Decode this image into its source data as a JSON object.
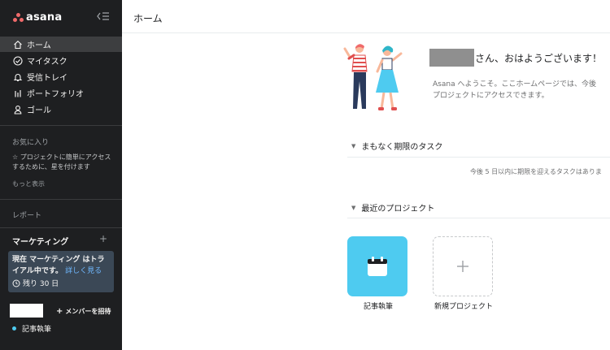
{
  "brand": {
    "name": "asana",
    "logo_color": "#f06a6a"
  },
  "sidebar": {
    "nav": [
      {
        "label": "ホーム",
        "icon": "home-icon",
        "active": true
      },
      {
        "label": "マイタスク",
        "icon": "check-circle-icon",
        "active": false
      },
      {
        "label": "受信トレイ",
        "icon": "bell-icon",
        "active": false
      },
      {
        "label": "ポートフォリオ",
        "icon": "bar-chart-icon",
        "active": false
      },
      {
        "label": "ゴール",
        "icon": "person-icon",
        "active": false
      }
    ],
    "favorites": {
      "title": "お気に入り",
      "hint": "☆ プロジェクトに簡単にアクセスするために、星を付けます",
      "more": "もっと表示"
    },
    "reports": {
      "title": "レポート"
    },
    "team": {
      "name": "マーケティング",
      "add": "+"
    },
    "trial": {
      "text": "現在 マーケティング はトライアル中です。",
      "link": "詳しく見る",
      "days": "残り 30 日"
    },
    "invite": "メンバーを招待",
    "project": {
      "label": "記事執筆",
      "color": "#4ecbf0"
    }
  },
  "main": {
    "title": "ホーム",
    "greeting": "さん、おはようございます！",
    "welcome_line1": "Asana へようこそ。ここホームページでは、今後",
    "welcome_line2": "プロジェクトにアクセスできます。",
    "upcoming": {
      "title": "まもなく期限のタスク",
      "empty": "今後 5 日以内に期限を迎えるタスクはありま"
    },
    "recent": {
      "title": "最近のプロジェクト",
      "projects": [
        {
          "label": "記事執筆",
          "color": "#4ecbf0",
          "icon": "calendar-icon"
        },
        {
          "label": "新規プロジェクト",
          "icon": "plus-icon"
        }
      ]
    }
  }
}
